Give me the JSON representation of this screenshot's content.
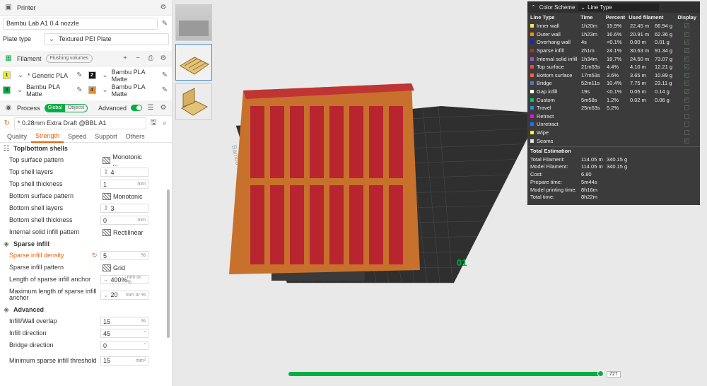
{
  "printer": {
    "label": "Printer",
    "name": "Bambu Lab A1 0.4 nozzle",
    "plate_type_label": "Plate type",
    "plate_type": "Textured PEI Plate"
  },
  "filament": {
    "label": "Filament",
    "flush_label": "Flushing volumes",
    "items": [
      {
        "slot": "1",
        "name": "* Generic PLA",
        "color": "#ecec3a"
      },
      {
        "slot": "2",
        "name": "Bambu PLA Matte",
        "color": "#111111"
      },
      {
        "slot": "3",
        "name": "Bambu PLA Matte",
        "color": "#00ae42"
      },
      {
        "slot": "4",
        "name": "Bambu PLA Matte",
        "color": "#f28d20"
      }
    ]
  },
  "process": {
    "label": "Process",
    "global": "Global",
    "objects": "Objects",
    "advanced": "Advanced",
    "preset": "* 0.28mm Extra Draft @BBL A1",
    "tabs": [
      "Quality",
      "Strength",
      "Speed",
      "Support",
      "Others"
    ],
    "sections": {
      "topbottom": "Top/bottom shells",
      "sparse": "Sparse infill",
      "advanced": "Advanced"
    },
    "params": {
      "top_surface_pattern": {
        "label": "Top surface pattern",
        "value": "Monotonic ..."
      },
      "top_shell_layers": {
        "label": "Top shell layers",
        "value": "4"
      },
      "top_shell_thickness": {
        "label": "Top shell thickness",
        "value": "1",
        "unit": "mm"
      },
      "bottom_surface_pattern": {
        "label": "Bottom surface pattern",
        "value": "Monotonic"
      },
      "bottom_shell_layers": {
        "label": "Bottom shell layers",
        "value": "3"
      },
      "bottom_shell_thickness": {
        "label": "Bottom shell thickness",
        "value": "0",
        "unit": "mm"
      },
      "internal_solid_pattern": {
        "label": "Internal solid infill pattern",
        "value": "Rectilinear"
      },
      "sparse_density": {
        "label": "Sparse infill density",
        "value": "5",
        "unit": "%"
      },
      "sparse_pattern": {
        "label": "Sparse infill pattern",
        "value": "Grid"
      },
      "length_anchor": {
        "label": "Length of sparse infill anchor",
        "value": "400%",
        "unit": "mm or %"
      },
      "max_length_anchor": {
        "label": "Maximum length of sparse infill anchor",
        "value": "20",
        "unit": "mm or %"
      },
      "overlap": {
        "label": "Infill/Wall overlap",
        "value": "15",
        "unit": "%"
      },
      "infill_direction": {
        "label": "Infill direction",
        "value": "45",
        "unit": "°"
      },
      "bridge_direction": {
        "label": "Bridge direction",
        "value": "0",
        "unit": "°"
      },
      "min_sparse_threshold": {
        "label": "Minimum sparse infill threshold",
        "value": "15",
        "unit": "mm²"
      }
    }
  },
  "color_scheme": {
    "title": "Color Scheme",
    "mode": "Line Type",
    "headers": [
      "Line Type",
      "Time",
      "Percent",
      "Used filament",
      "Display"
    ],
    "rows": [
      {
        "name": "Inner wall",
        "time": "1h20m",
        "percent": "15.9%",
        "len": "22.45 m",
        "g": "66.94 g",
        "color": "#ffe64c",
        "display": true
      },
      {
        "name": "Outer wall",
        "time": "1h23m",
        "percent": "16.6%",
        "len": "20.91 m",
        "g": "62.36 g",
        "color": "#ff8c00",
        "display": true
      },
      {
        "name": "Overhang wall",
        "time": "4s",
        "percent": "<0.1%",
        "len": "0.00 m",
        "g": "0.01 g",
        "color": "#1f1fd6",
        "display": true
      },
      {
        "name": "Sparse infill",
        "time": "2h1m",
        "percent": "24.1%",
        "len": "30.63 m",
        "g": "91.34 g",
        "color": "#b03029",
        "display": true
      },
      {
        "name": "Internal solid infill",
        "time": "1h34m",
        "percent": "18.7%",
        "len": "24.50 m",
        "g": "73.07 g",
        "color": "#9654cc",
        "display": true
      },
      {
        "name": "Top surface",
        "time": "21m53s",
        "percent": "4.4%",
        "len": "4.10 m",
        "g": "12.21 g",
        "color": "#f04545",
        "display": true
      },
      {
        "name": "Bottom surface",
        "time": "17m53s",
        "percent": "3.6%",
        "len": "3.65 m",
        "g": "10.89 g",
        "color": "#ff5e3a",
        "display": true
      },
      {
        "name": "Bridge",
        "time": "52m11s",
        "percent": "10.4%",
        "len": "7.75 m",
        "g": "23.11 g",
        "color": "#4d80ba",
        "display": true
      },
      {
        "name": "Gap infill",
        "time": "19s",
        "percent": "<0.1%",
        "len": "0.05 m",
        "g": "0.14 g",
        "color": "#ffffff",
        "display": true
      },
      {
        "name": "Custom",
        "time": "5m58s",
        "percent": "1.2%",
        "len": "0.02 m",
        "g": "0.06 g",
        "color": "#00c96b",
        "display": true
      },
      {
        "name": "Travel",
        "time": "25m53s",
        "percent": "5.2%",
        "len": "",
        "g": "",
        "color": "#38d",
        "display": false
      },
      {
        "name": "Retract",
        "time": "",
        "percent": "",
        "len": "",
        "g": "",
        "color": "#ff00ff",
        "display": false
      },
      {
        "name": "Unretract",
        "time": "",
        "percent": "",
        "len": "",
        "g": "",
        "color": "#1f6fff",
        "display": false
      },
      {
        "name": "Wipe",
        "time": "",
        "percent": "",
        "len": "",
        "g": "",
        "color": "#ffff00",
        "display": false
      },
      {
        "name": "Seams",
        "time": "",
        "percent": "",
        "len": "",
        "g": "",
        "color": "#e0e0e0",
        "display": true
      }
    ],
    "total_title": "Total Estimation",
    "totals": [
      {
        "k": "Total Filament:",
        "v1": "114.05 m",
        "v2": "340.15 g"
      },
      {
        "k": "Model Filament:",
        "v1": "114.05 m",
        "v2": "340.15 g"
      },
      {
        "k": "Cost:",
        "v1": "6.80",
        "v2": ""
      },
      {
        "k": "Prepare time:",
        "v1": "5m44s",
        "v2": ""
      },
      {
        "k": "Model printing time:",
        "v1": "8h16m",
        "v2": ""
      },
      {
        "k": "Total time:",
        "v1": "8h22m",
        "v2": ""
      }
    ]
  },
  "plate": {
    "label": "Bambu Textured PEI Plate",
    "number": "01"
  },
  "slider": {
    "value": "727"
  }
}
